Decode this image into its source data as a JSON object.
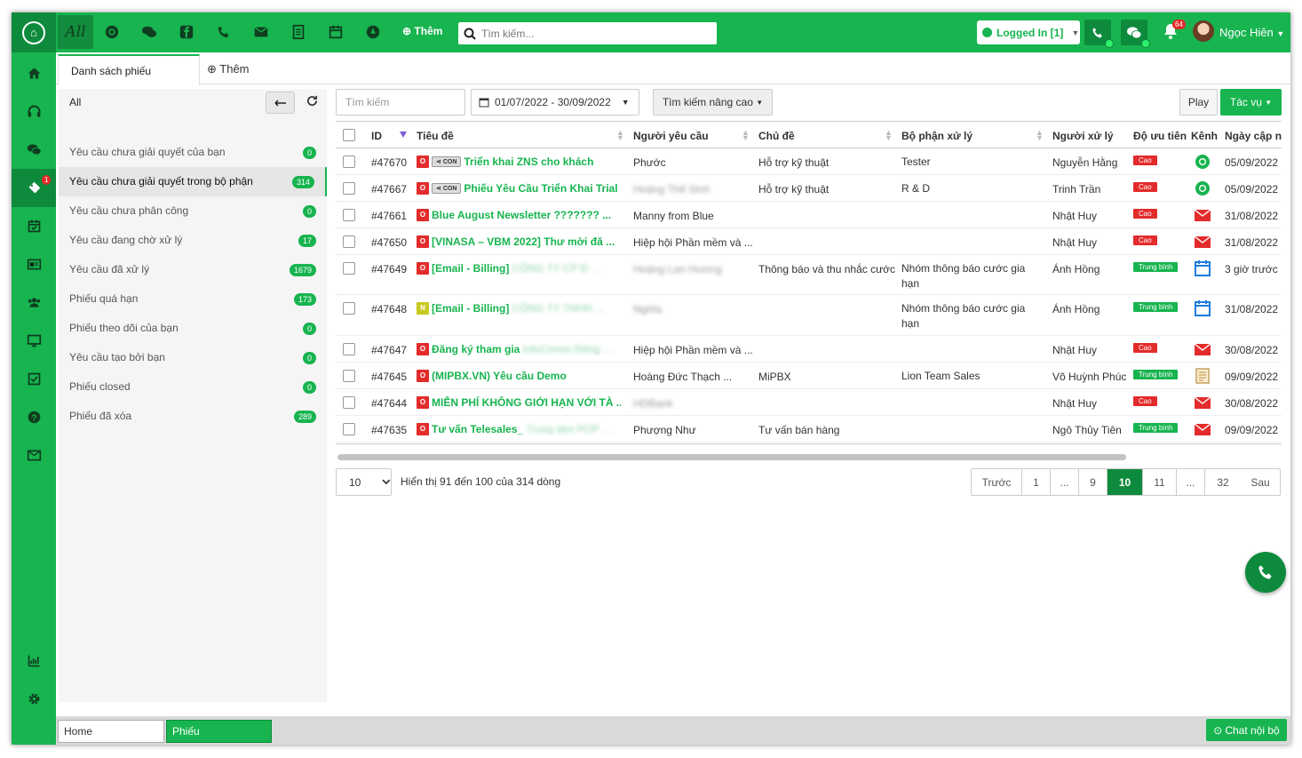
{
  "header": {
    "all_label": "All",
    "add_label": "Thêm",
    "search_placeholder": "Tìm kiếm...",
    "status": "Logged In [1]",
    "notif_count": "64",
    "user_name": "Ngọc Hiên"
  },
  "sidebar": {
    "ticket_badge": "1"
  },
  "tabs": {
    "list": "Danh sách phiếu",
    "add": "Thêm"
  },
  "left": {
    "title": "All",
    "items": [
      {
        "label": "Yêu cầu chưa giải quyết của bạn",
        "count": "0"
      },
      {
        "label": "Yêu cầu chưa giải quyết trong bộ phận",
        "count": "314"
      },
      {
        "label": "Yêu cầu chưa phân công",
        "count": "0"
      },
      {
        "label": "Yêu cầu đang chờ xử lý",
        "count": "17"
      },
      {
        "label": "Yêu cầu đã xử lý",
        "count": "1679"
      },
      {
        "label": "Phiếu quá hạn",
        "count": "173"
      },
      {
        "label": "Phiếu theo dõi của bạn",
        "count": "0"
      },
      {
        "label": "Yêu cầu tạo bởi bạn",
        "count": "0"
      },
      {
        "label": "Phiếu closed",
        "count": "0"
      },
      {
        "label": "Phiếu đã xóa",
        "count": "289"
      }
    ]
  },
  "filters": {
    "search_placeholder": "Tìm kiếm",
    "date_range": "01/07/2022 - 30/09/2022",
    "advanced": "Tìm kiếm nâng cao",
    "play": "Play",
    "actions": "Tác vụ"
  },
  "table": {
    "headers": {
      "id": "ID",
      "title": "Tiêu đề",
      "requester": "Người yêu cầu",
      "topic": "Chủ đề",
      "dept": "Bộ phận xử lý",
      "handler": "Người xử lý",
      "priority": "Độ ưu tiên",
      "channel": "Kênh",
      "updated": "Ngày cập nh"
    },
    "rows": [
      {
        "id": "#47670",
        "p": "O",
        "con": "CON",
        "title": "Triển khai ZNS cho khách",
        "blur": "",
        "requester": "Phước",
        "req_blur": false,
        "topic": "Hỗ trợ kỹ thuật",
        "dept": "Tester",
        "handler": "Nguyễn Hằng",
        "priority": "Cao",
        "channel": "chrome",
        "updated": "05/09/2022"
      },
      {
        "id": "#47667",
        "p": "O",
        "con": "CON",
        "title": "Phiếu Yêu Cầu Triển Khai Trial ...",
        "blur": "",
        "requester": "Hoàng Thế Sinh",
        "req_blur": true,
        "topic": "Hỗ trợ kỹ thuật",
        "dept": "R & D",
        "handler": "Trinh Trần",
        "priority": "Cao",
        "channel": "chrome",
        "updated": "05/09/2022"
      },
      {
        "id": "#47661",
        "p": "O",
        "con": "",
        "title": "Blue August Newsletter ??????? ...",
        "blur": "",
        "requester": "Manny from Blue",
        "req_blur": false,
        "topic": "",
        "dept": "",
        "handler": "Nhật Huy",
        "priority": "Cao",
        "channel": "email",
        "updated": "31/08/2022"
      },
      {
        "id": "#47650",
        "p": "O",
        "con": "",
        "title": "[VINASA – VBM 2022] Thư mời đă ...",
        "blur": "",
        "requester": "Hiệp hội Phần mềm và ...",
        "req_blur": false,
        "topic": "",
        "dept": "",
        "handler": "Nhật Huy",
        "priority": "Cao",
        "channel": "email",
        "updated": "31/08/2022"
      },
      {
        "id": "#47649",
        "p": "O",
        "con": "",
        "title": "[Email - Billing]",
        "blur": "CÔNG TY CP Đ ...",
        "requester": "Hoàng Lan Hương",
        "req_blur": true,
        "topic": "Thông báo và thu nhắc cước",
        "dept": "Nhóm thông báo cước gia hạn",
        "handler": "Ánh Hồng",
        "priority": "Trung bình",
        "channel": "calendar",
        "updated": "3 giờ trước"
      },
      {
        "id": "#47648",
        "p": "N",
        "con": "",
        "title": "[Email - Billing]",
        "blur": "CÔNG TY TNHH ...",
        "requester": "Nghĩa",
        "req_blur": true,
        "topic": "",
        "dept": "Nhóm thông báo cước gia hạn",
        "handler": "Ánh Hồng",
        "priority": "Trung bình",
        "channel": "calendar",
        "updated": "31/08/2022"
      },
      {
        "id": "#47647",
        "p": "O",
        "con": "",
        "title": "Đăng ký tham gia",
        "blur": "InfoComm Đông ...",
        "requester": "Hiệp hội Phần mềm và ...",
        "req_blur": false,
        "topic": "",
        "dept": "",
        "handler": "Nhật Huy",
        "priority": "Cao",
        "channel": "email",
        "updated": "30/08/2022"
      },
      {
        "id": "#47645",
        "p": "O",
        "con": "",
        "title": "(MIPBX.VN) Yêu cầu Demo",
        "blur": "",
        "requester": "Hoàng Đức Thạch ...",
        "req_blur": false,
        "topic": "MiPBX",
        "dept": "Lion Team Sales",
        "handler": "Võ Huỳnh Phúc",
        "priority": "Trung bình",
        "channel": "form",
        "updated": "09/09/2022"
      },
      {
        "id": "#47644",
        "p": "O",
        "con": "",
        "title": "MIỄN PHÍ KHÔNG GIỚI HẠN VỚI TÀ ...",
        "blur": "",
        "requester": "HDBank",
        "req_blur": true,
        "topic": "",
        "dept": "",
        "handler": "Nhật Huy",
        "priority": "Cao",
        "channel": "email",
        "updated": "30/08/2022"
      },
      {
        "id": "#47635",
        "p": "O",
        "con": "",
        "title": "Tư vấn Telesales_",
        "blur": "Trung tâm POP ...",
        "requester": "Phượng Như",
        "req_blur": false,
        "topic": "Tư vấn bán hàng",
        "dept": "",
        "handler": "Ngô Thủy Tiên",
        "priority": "Trung bình",
        "channel": "email",
        "updated": "09/09/2022"
      }
    ]
  },
  "pagination": {
    "page_size": "10",
    "info": "Hiển thị 91 đến 100 của 314 dòng",
    "prev": "Trước",
    "next": "Sau",
    "pages": [
      "1",
      "...",
      "9",
      "10",
      "11",
      "...",
      "32"
    ],
    "current": "10"
  },
  "bottom": {
    "home": "Home",
    "phieu": "Phiếu",
    "chat": "Chat nội bộ"
  },
  "colors": {
    "brand": "#17b44f",
    "brand_dark": "#0e8a3c",
    "priority_high": "#e32b2b",
    "priority_medium": "#17b44f"
  }
}
